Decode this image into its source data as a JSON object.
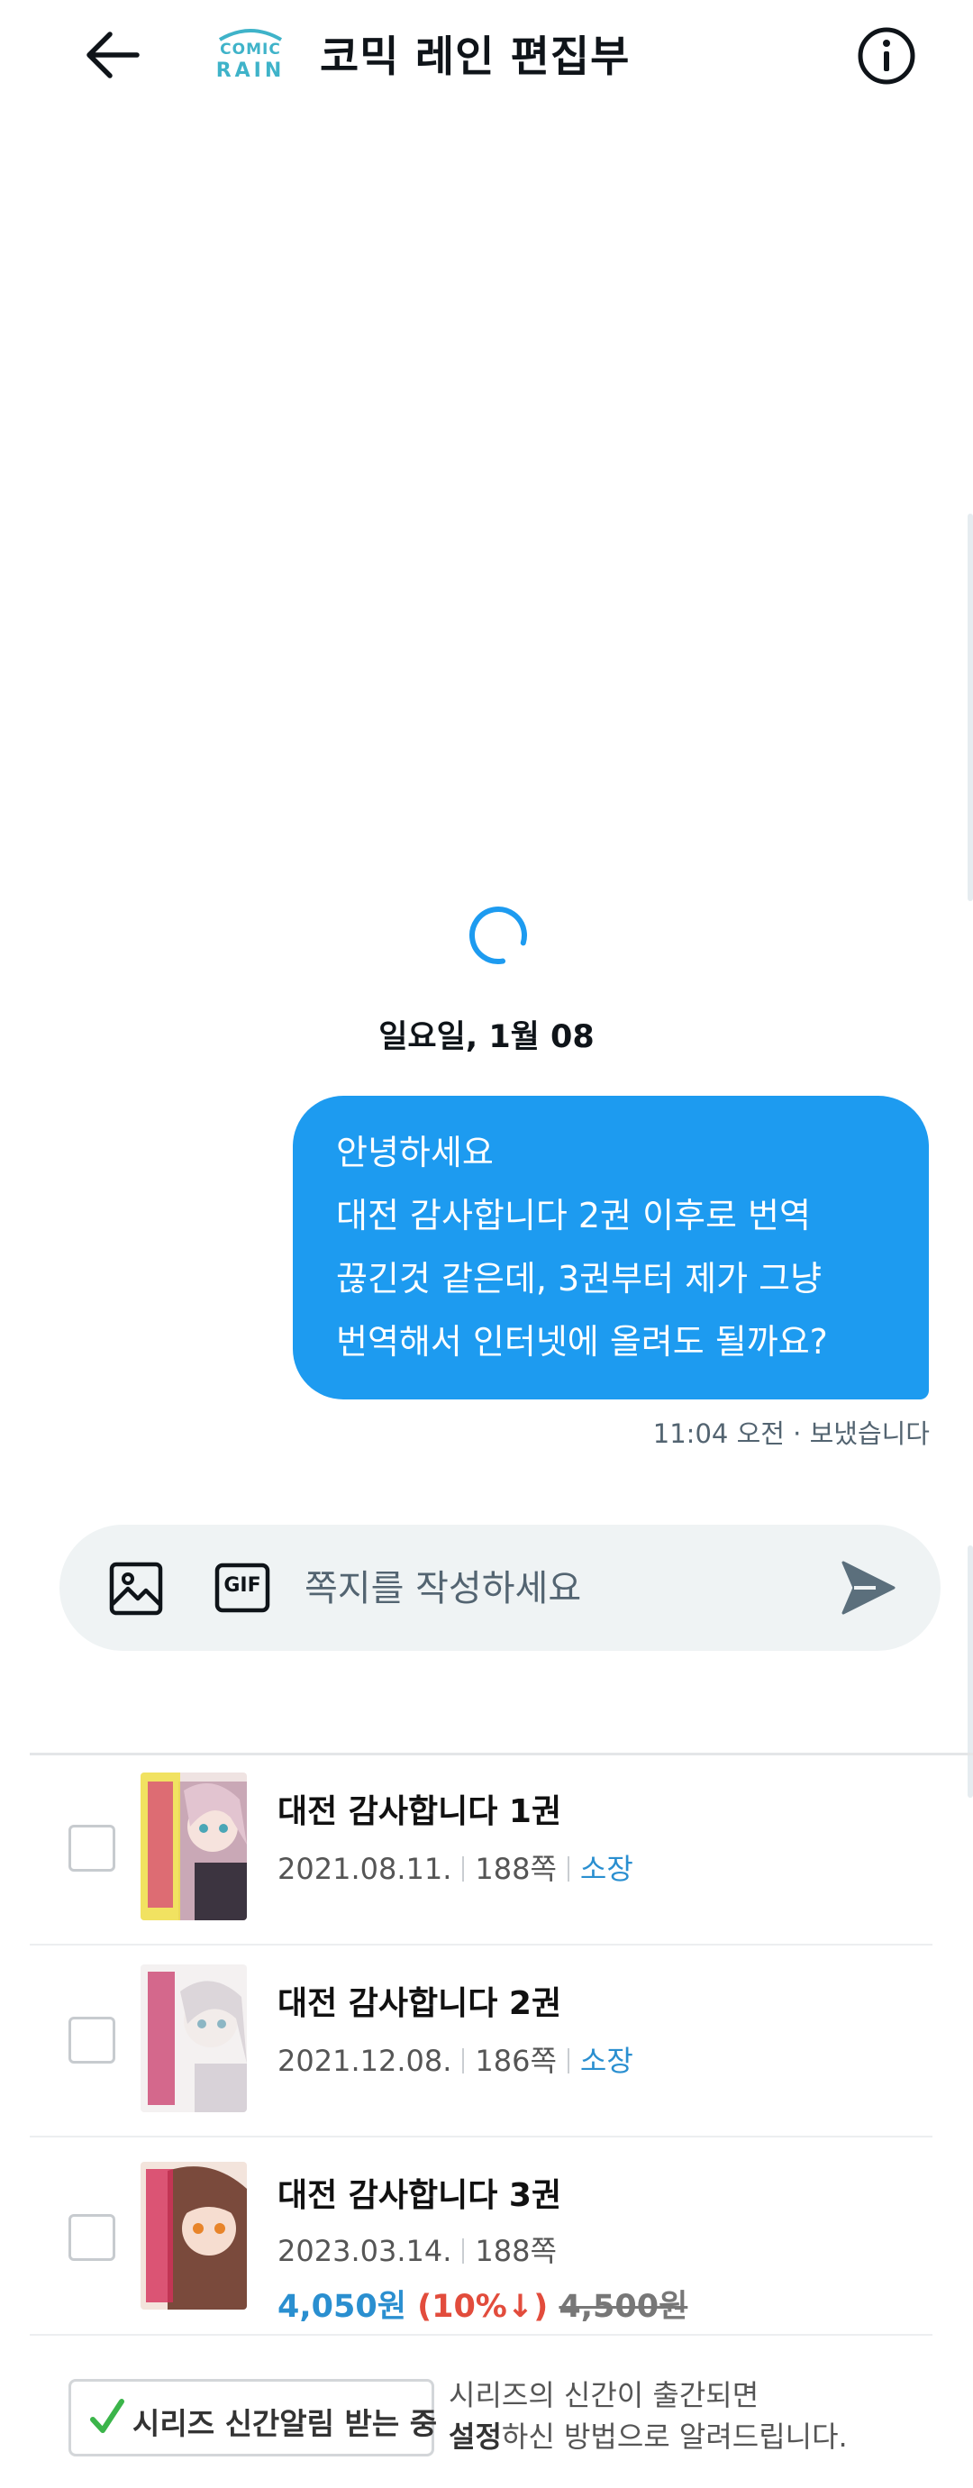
{
  "header": {
    "title": "코믹 레인 편집부",
    "logo_text": "COMIC RAIN",
    "back_icon": "arrow-left-icon",
    "info_icon": "info-circle-icon"
  },
  "conversation": {
    "date_label": "일요일, 1월 08",
    "message": {
      "lines": [
        "안녕하세요",
        "대전 감사합니다 2권 이후로 번역",
        "끊긴것 같은데, 3권부터 제가 그냥",
        "번역해서 인터넷에 올려도 될까요?"
      ],
      "meta": "11:04 오전 · 보냈습니다"
    }
  },
  "composer": {
    "placeholder": "쪽지를 작성하세요",
    "gif_label": "GIF",
    "image_icon": "image-icon",
    "send_icon": "send-icon"
  },
  "books": [
    {
      "title": "대전 감사합니다 1권",
      "date": "2021.08.11.",
      "pages": "188쪽",
      "status": "소장"
    },
    {
      "title": "대전 감사합니다 2권",
      "date": "2021.12.08.",
      "pages": "186쪽",
      "status": "소장"
    },
    {
      "title": "대전 감사합니다 3권",
      "date": "2023.03.14.",
      "pages": "188쪽",
      "price": "4,050원",
      "discount": "(10%↓)",
      "original_price": "4,500원"
    }
  ],
  "series": {
    "button_label": "시리즈 신간알림 받는 중",
    "note_line1": "시리즈의 신간이 출간되면",
    "note_bold": "설정",
    "note_line2_rest": "하신 방법으로 알려드립니다."
  },
  "colors": {
    "bubble": "#1d9bf0",
    "owned": "#2a8fd0",
    "discount": "#e24c3c",
    "composer_bg": "#eff3f4"
  }
}
